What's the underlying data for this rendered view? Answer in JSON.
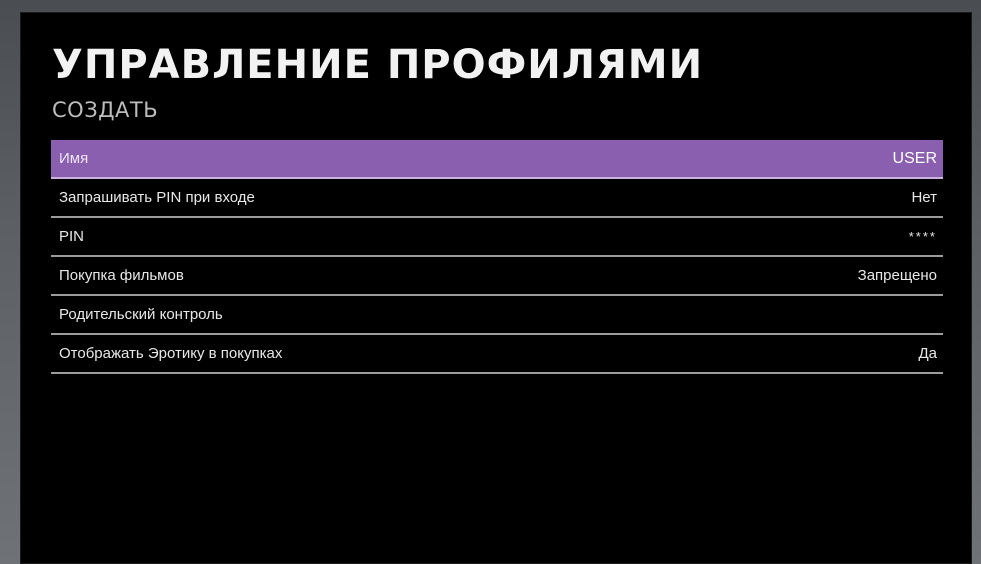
{
  "header": {
    "title": "УПРАВЛЕНИЕ ПРОФИЛЯМИ",
    "subtitle": "СОЗДАТЬ"
  },
  "settings": [
    {
      "label": "Имя",
      "value": "USER",
      "selected": true
    },
    {
      "label": "Запрашивать PIN при входе",
      "value": "Нет",
      "selected": false
    },
    {
      "label": "PIN",
      "value": "****",
      "selected": false
    },
    {
      "label": "Покупка фильмов",
      "value": "Запрещено",
      "selected": false
    },
    {
      "label": "Родительский контроль",
      "value": "",
      "selected": false
    },
    {
      "label": "Отображать Эротику в покупках",
      "value": "Да",
      "selected": false
    }
  ],
  "colors": {
    "background": "#000000",
    "selection": "#8a5fb0",
    "divider": "#9c9c9c",
    "text": "#e8e8e8"
  }
}
